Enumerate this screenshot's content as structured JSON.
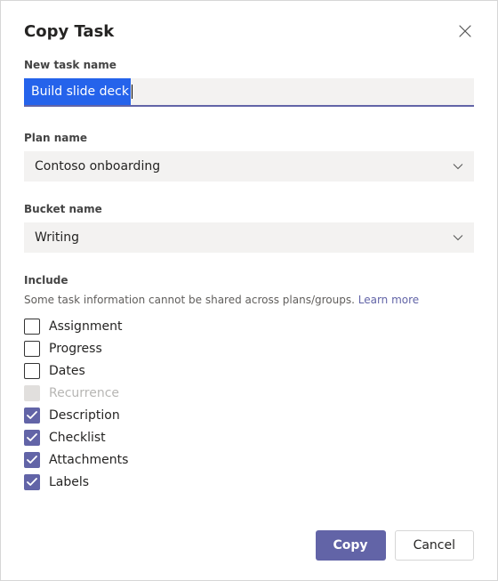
{
  "dialog": {
    "title": "Copy Task"
  },
  "taskName": {
    "label": "New task name",
    "value": "Build slide deck"
  },
  "plan": {
    "label": "Plan name",
    "value": "Contoso onboarding"
  },
  "bucket": {
    "label": "Bucket name",
    "value": "Writing"
  },
  "include": {
    "label": "Include",
    "desc": "Some task information cannot be shared across plans/groups. ",
    "learnMore": "Learn more",
    "items": [
      {
        "id": "assignment",
        "label": "Assignment",
        "checked": false,
        "disabled": false
      },
      {
        "id": "progress",
        "label": "Progress",
        "checked": false,
        "disabled": false
      },
      {
        "id": "dates",
        "label": "Dates",
        "checked": false,
        "disabled": false
      },
      {
        "id": "recurrence",
        "label": "Recurrence",
        "checked": false,
        "disabled": true
      },
      {
        "id": "description",
        "label": "Description",
        "checked": true,
        "disabled": false
      },
      {
        "id": "checklist",
        "label": "Checklist",
        "checked": true,
        "disabled": false
      },
      {
        "id": "attachments",
        "label": "Attachments",
        "checked": true,
        "disabled": false
      },
      {
        "id": "labels",
        "label": "Labels",
        "checked": true,
        "disabled": false
      }
    ]
  },
  "buttons": {
    "primary": "Copy",
    "secondary": "Cancel"
  }
}
